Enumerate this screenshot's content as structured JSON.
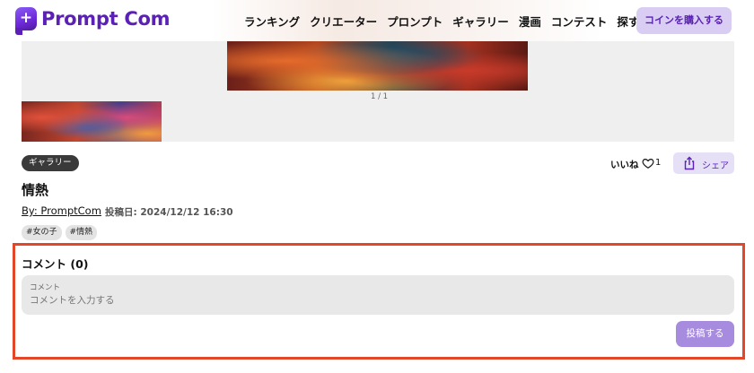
{
  "header": {
    "logo_text": "Prompt Com",
    "nav": [
      "ランキング",
      "クリエーター",
      "プロンプト",
      "ギャラリー",
      "漫画",
      "コンテスト",
      "探す"
    ],
    "buy_coin_label": "コインを購入する"
  },
  "gallery": {
    "counter": "1 / 1"
  },
  "post": {
    "category": "ギャラリー",
    "like_label": "いいね",
    "like_count": "1",
    "share_label": "シェア",
    "title": "情熱",
    "author": "By: PromptCom",
    "posted": "投稿日: 2024/12/12 16:30",
    "tags": [
      "#女の子",
      "#情熱"
    ]
  },
  "comments": {
    "heading": "コメント (0)",
    "field_label": "コメント",
    "placeholder": "コメントを入力する",
    "submit_label": "投稿する"
  },
  "colors": {
    "brand": "#5b21b6",
    "highlight_border": "#e2472a",
    "submit_bg": "#a78bdf"
  }
}
